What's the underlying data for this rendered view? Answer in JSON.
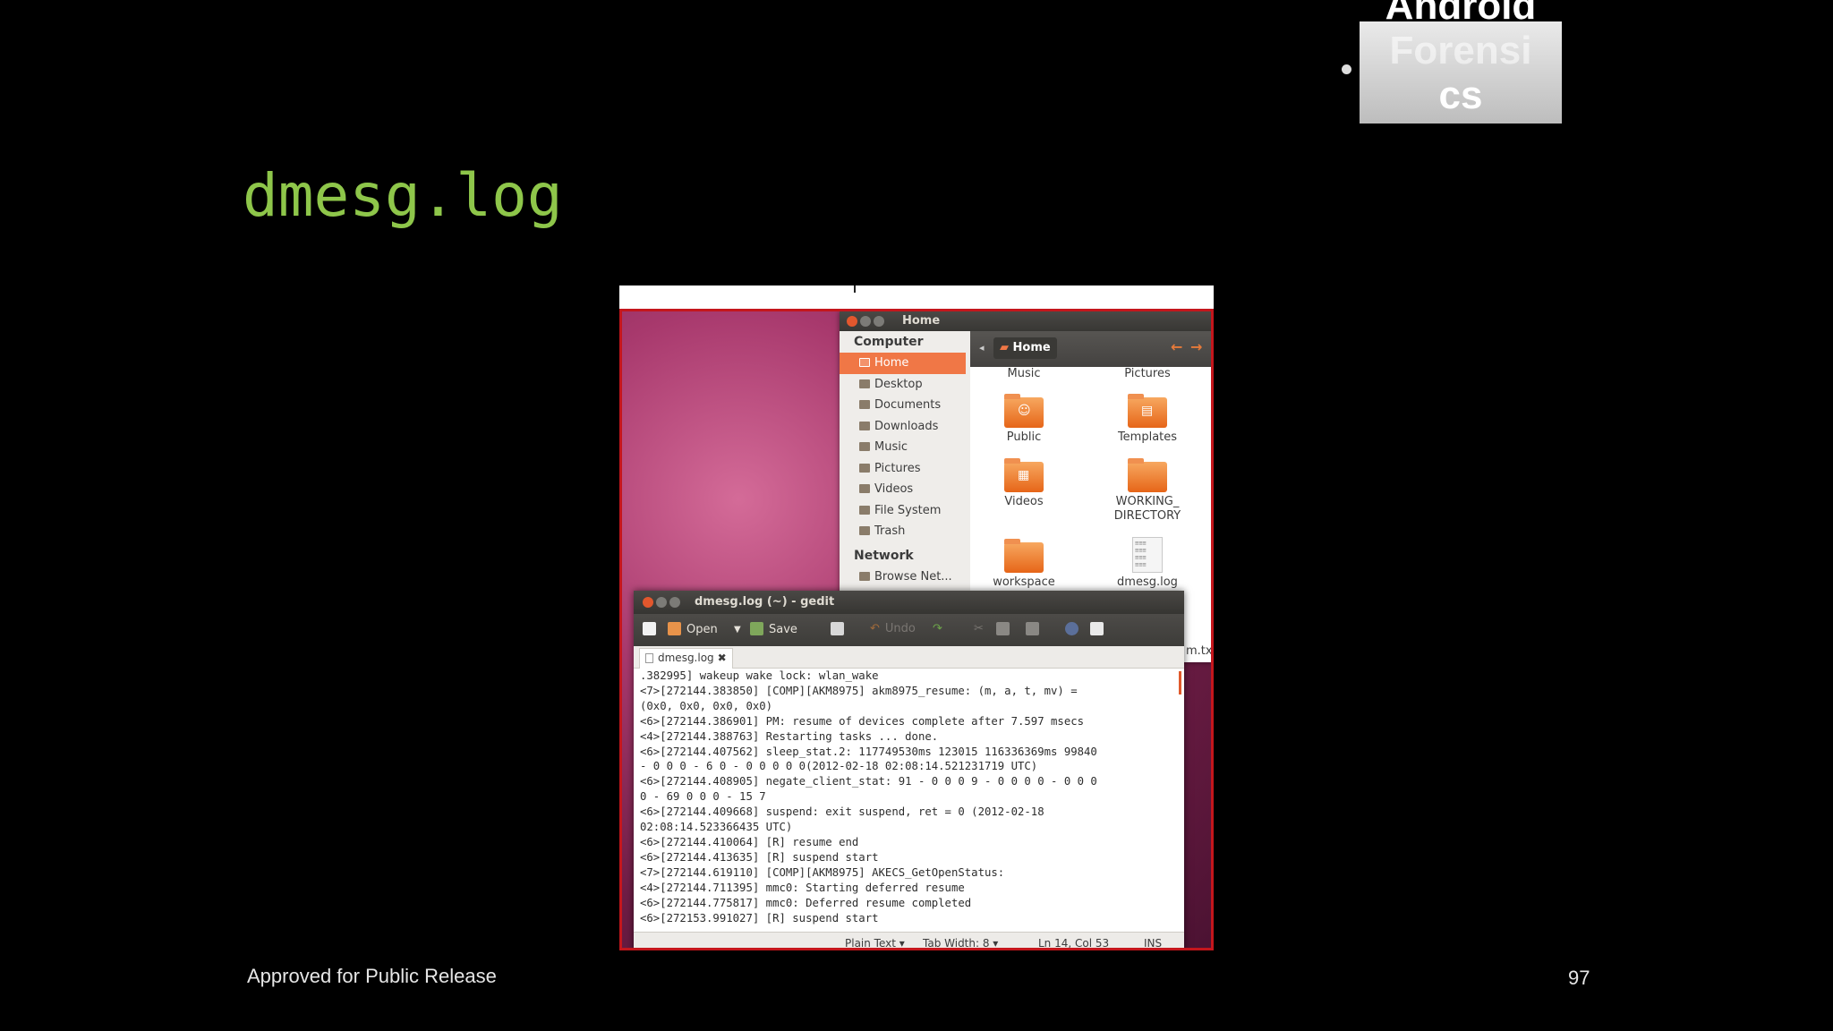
{
  "header_logo": {
    "text_line1": "Android",
    "text_line2": "Forensi",
    "text_line3": "cs"
  },
  "slide": {
    "title": "dmesg.log",
    "footer_left": "Approved for Public Release",
    "page_number": "97"
  },
  "nautilus": {
    "window_title": "Home",
    "sidebar": {
      "computer_heading": "Computer",
      "items": [
        {
          "label": "Home",
          "icon": "home-folder-icon",
          "active": true
        },
        {
          "label": "Desktop",
          "icon": "desktop-icon"
        },
        {
          "label": "Documents",
          "icon": "documents-icon"
        },
        {
          "label": "Downloads",
          "icon": "downloads-icon"
        },
        {
          "label": "Music",
          "icon": "music-icon"
        },
        {
          "label": "Pictures",
          "icon": "pictures-icon"
        },
        {
          "label": "Videos",
          "icon": "videos-icon"
        },
        {
          "label": "File System",
          "icon": "filesystem-icon"
        },
        {
          "label": "Trash",
          "icon": "trash-icon"
        }
      ],
      "network_heading": "Network",
      "network_items": [
        {
          "label": "Browse Net...",
          "icon": "network-icon"
        }
      ]
    },
    "breadcrumb": {
      "current": "Home"
    },
    "files": [
      {
        "label": "Music"
      },
      {
        "label": "Pictures"
      },
      {
        "label": "Public"
      },
      {
        "label": "Templates"
      },
      {
        "label": "Videos"
      },
      {
        "label": "WORKING_",
        "label2": "DIRECTORY"
      },
      {
        "label": "workspace"
      },
      {
        "label": "dmesg.log"
      }
    ],
    "partial_file": "m.txt"
  },
  "gedit": {
    "window_title": "dmesg.log (~) - gedit",
    "toolbar": {
      "open": "Open",
      "save": "Save",
      "undo": "Undo"
    },
    "tab_label": "dmesg.log",
    "text": ".382995] wakeup wake lock: wlan_wake\n<7>[272144.383850] [COMP][AKM8975] akm8975_resume: (m, a, t, mv) =\n(0x0, 0x0, 0x0, 0x0)\n<6>[272144.386901] PM: resume of devices complete after 7.597 msecs\n<4>[272144.388763] Restarting tasks ... done.\n<6>[272144.407562] sleep_stat.2: 117749530ms 123015 116336369ms 99840\n- 0 0 0 - 6 0 - 0 0 0 0 0(2012-02-18 02:08:14.521231719 UTC)\n<6>[272144.408905] negate_client_stat: 91 - 0 0 0 9 - 0 0 0 0 - 0 0 0\n0 - 69 0 0 0 - 15 7\n<6>[272144.409668] suspend: exit suspend, ret = 0 (2012-02-18\n02:08:14.523366435 UTC)\n<6>[272144.410064] [R] resume end\n<6>[272144.413635] [R] suspend start\n<7>[272144.619110] [COMP][AKM8975] AKECS_GetOpenStatus:\n<4>[272144.711395] mmc0: Starting deferred resume\n<6>[272144.775817] mmc0: Deferred resume completed\n<6>[272153.991027] [R] suspend start",
    "status": {
      "language": "Plain Text",
      "tab_width": "Tab Width: 8",
      "position": "Ln 14, Col 53",
      "mode": "INS"
    }
  }
}
